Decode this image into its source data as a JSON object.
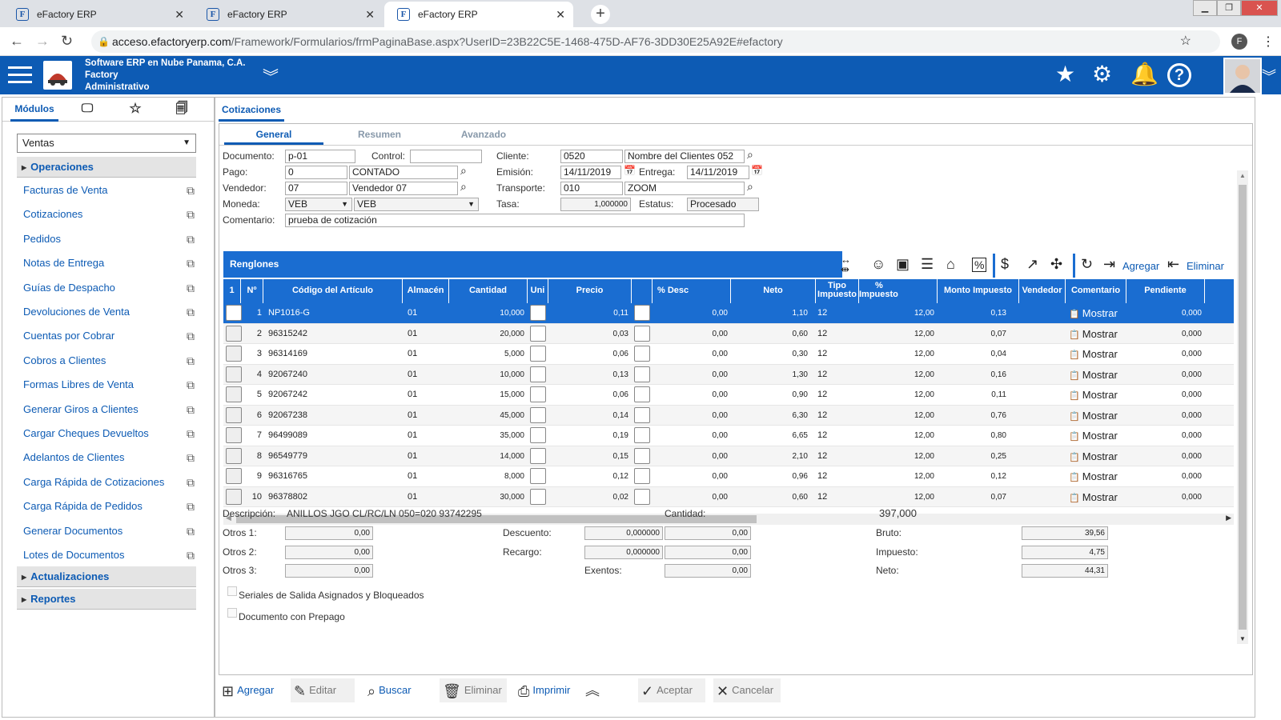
{
  "browser": {
    "tabs": [
      {
        "title": "eFactory ERP"
      },
      {
        "title": "eFactory ERP"
      },
      {
        "title": "eFactory ERP"
      }
    ],
    "url_host": "acceso.efactoryerp.com",
    "url_path": "/Framework/Formularios/frmPaginaBase.aspx?UserID=23B22C5E-1468-475D-AF76-3DD30E25A92E#efactory"
  },
  "header": {
    "company_line1": "Software ERP en Nube Panama, C.A.",
    "company_line2": "Factory",
    "company_line3": "Administrativo"
  },
  "sidebar": {
    "tabs": {
      "modulos": "Módulos"
    },
    "module_select": "Ventas",
    "group_operaciones": "Operaciones",
    "items": [
      {
        "label": "Facturas de Venta"
      },
      {
        "label": "Cotizaciones"
      },
      {
        "label": "Pedidos"
      },
      {
        "label": "Notas de Entrega"
      },
      {
        "label": "Guías de Despacho"
      },
      {
        "label": "Devoluciones de Venta"
      },
      {
        "label": "Cuentas por Cobrar"
      },
      {
        "label": "Cobros a Clientes"
      },
      {
        "label": "Formas Libres de Venta"
      },
      {
        "label": "Generar Giros a Clientes"
      },
      {
        "label": "Cargar Cheques Devueltos"
      },
      {
        "label": "Adelantos de Clientes"
      },
      {
        "label": "Carga Rápida de Cotizaciones"
      },
      {
        "label": "Carga Rápida de Pedidos"
      },
      {
        "label": "Generar Documentos"
      },
      {
        "label": "Lotes de Documentos"
      }
    ],
    "group_actualizaciones": "Actualizaciones",
    "group_reportes": "Reportes"
  },
  "main": {
    "tab": "Cotizaciones",
    "subtabs": {
      "general": "General",
      "resumen": "Resumen",
      "avanzado": "Avanzado"
    }
  },
  "form": {
    "documento_label": "Documento:",
    "documento": "p-01",
    "control_label": "Control:",
    "control": "",
    "cliente_label": "Cliente:",
    "cliente_code": "0520",
    "cliente_name": "Nombre del Clientes 052",
    "pago_label": "Pago:",
    "pago_code": "0",
    "pago_name": "CONTADO",
    "emision_label": "Emisión:",
    "emision": "14/11/2019",
    "entrega_label": "Entrega:",
    "entrega": "14/11/2019",
    "vendedor_label": "Vendedor:",
    "vendedor_code": "07",
    "vendedor_name": "Vendedor 07",
    "transporte_label": "Transporte:",
    "transporte_code": "010",
    "transporte_name": "ZOOM",
    "moneda_label": "Moneda:",
    "moneda_code": "VEB",
    "moneda_name": "VEB",
    "tasa_label": "Tasa:",
    "tasa": "1,000000",
    "estatus_label": "Estatus:",
    "estatus": "Procesado",
    "comentario_label": "Comentario:",
    "comentario": "prueba de cotización"
  },
  "renglones": {
    "title": "Renglones",
    "agregar": "Agregar",
    "eliminar": "Eliminar",
    "columns": {
      "chk": "1",
      "num": "Nº",
      "codigo": "Código del Artículo",
      "almacen": "Almacén",
      "cantidad": "Cantidad",
      "uni": "Uni",
      "precio": "Precio",
      "desc": "% Desc",
      "neto": "Neto",
      "tipo1": "Tipo",
      "tipo2": "Impuesto",
      "pimp1": "%",
      "pimp2": "Impuesto",
      "monto_imp": "Monto Impuesto",
      "vendedor": "Vendedor",
      "comentario": "Comentario",
      "pendiente": "Pendiente"
    },
    "rows": [
      {
        "n": "1",
        "codigo": "NP1016-G",
        "almacen": "01",
        "cantidad": "10,000",
        "precio": "0,11",
        "desc": "0,00",
        "neto": "1,10",
        "tipo": "12",
        "pimp": "12,00",
        "monto": "0,13",
        "comentario": "Mostrar",
        "pendiente": "0,000"
      },
      {
        "n": "2",
        "codigo": "96315242",
        "almacen": "01",
        "cantidad": "20,000",
        "precio": "0,03",
        "desc": "0,00",
        "neto": "0,60",
        "tipo": "12",
        "pimp": "12,00",
        "monto": "0,07",
        "comentario": "Mostrar",
        "pendiente": "0,000"
      },
      {
        "n": "3",
        "codigo": "96314169",
        "almacen": "01",
        "cantidad": "5,000",
        "precio": "0,06",
        "desc": "0,00",
        "neto": "0,30",
        "tipo": "12",
        "pimp": "12,00",
        "monto": "0,04",
        "comentario": "Mostrar",
        "pendiente": "0,000"
      },
      {
        "n": "4",
        "codigo": "92067240",
        "almacen": "01",
        "cantidad": "10,000",
        "precio": "0,13",
        "desc": "0,00",
        "neto": "1,30",
        "tipo": "12",
        "pimp": "12,00",
        "monto": "0,16",
        "comentario": "Mostrar",
        "pendiente": "0,000"
      },
      {
        "n": "5",
        "codigo": "92067242",
        "almacen": "01",
        "cantidad": "15,000",
        "precio": "0,06",
        "desc": "0,00",
        "neto": "0,90",
        "tipo": "12",
        "pimp": "12,00",
        "monto": "0,11",
        "comentario": "Mostrar",
        "pendiente": "0,000"
      },
      {
        "n": "6",
        "codigo": "92067238",
        "almacen": "01",
        "cantidad": "45,000",
        "precio": "0,14",
        "desc": "0,00",
        "neto": "6,30",
        "tipo": "12",
        "pimp": "12,00",
        "monto": "0,76",
        "comentario": "Mostrar",
        "pendiente": "0,000"
      },
      {
        "n": "7",
        "codigo": "96499089",
        "almacen": "01",
        "cantidad": "35,000",
        "precio": "0,19",
        "desc": "0,00",
        "neto": "6,65",
        "tipo": "12",
        "pimp": "12,00",
        "monto": "0,80",
        "comentario": "Mostrar",
        "pendiente": "0,000"
      },
      {
        "n": "8",
        "codigo": "96549779",
        "almacen": "01",
        "cantidad": "14,000",
        "precio": "0,15",
        "desc": "0,00",
        "neto": "2,10",
        "tipo": "12",
        "pimp": "12,00",
        "monto": "0,25",
        "comentario": "Mostrar",
        "pendiente": "0,000"
      },
      {
        "n": "9",
        "codigo": "96316765",
        "almacen": "01",
        "cantidad": "8,000",
        "precio": "0,12",
        "desc": "0,00",
        "neto": "0,96",
        "tipo": "12",
        "pimp": "12,00",
        "monto": "0,12",
        "comentario": "Mostrar",
        "pendiente": "0,000"
      },
      {
        "n": "10",
        "codigo": "96378802",
        "almacen": "01",
        "cantidad": "30,000",
        "precio": "0,02",
        "desc": "0,00",
        "neto": "0,60",
        "tipo": "12",
        "pimp": "12,00",
        "monto": "0,07",
        "comentario": "Mostrar",
        "pendiente": "0,000"
      }
    ]
  },
  "totals": {
    "descripcion_label": "Descripción:",
    "descripcion": "ANILLOS JGO CL/RC/LN 050=020 93742295",
    "cantidad_label": "Cantidad:",
    "cantidad": "397,000",
    "otros1_label": "Otros 1:",
    "otros1": "0,00",
    "otros2_label": "Otros 2:",
    "otros2": "0,00",
    "otros3_label": "Otros 3:",
    "otros3": "0,00",
    "descuento_label": "Descuento:",
    "descuento_pct": "0,000000",
    "descuento": "0,00",
    "recargo_label": "Recargo:",
    "recargo_pct": "0,000000",
    "recargo": "0,00",
    "exentos_label": "Exentos:",
    "exentos": "0,00",
    "bruto_label": "Bruto:",
    "bruto": "39,56",
    "impuesto_label": "Impuesto:",
    "impuesto": "4,75",
    "neto_label": "Neto:",
    "neto": "44,31",
    "seriales_label": "Seriales de Salida Asignados y Bloqueados",
    "prepago_label": "Documento con Prepago"
  },
  "actions": {
    "agregar": "Agregar",
    "editar": "Editar",
    "buscar": "Buscar",
    "eliminar": "Eliminar",
    "imprimir": "Imprimir",
    "aceptar": "Aceptar",
    "cancelar": "Cancelar"
  },
  "colors": {
    "brand": "#0d5bb4",
    "grid_header": "#1a6dd1"
  },
  "icons": [
    "hamburger-icon",
    "favorites-star-icon",
    "settings-gear-icon",
    "notifications-bell-icon",
    "help-icon",
    "search-icon",
    "calendar-icon",
    "external-link-icon",
    "clipboard-icon"
  ]
}
